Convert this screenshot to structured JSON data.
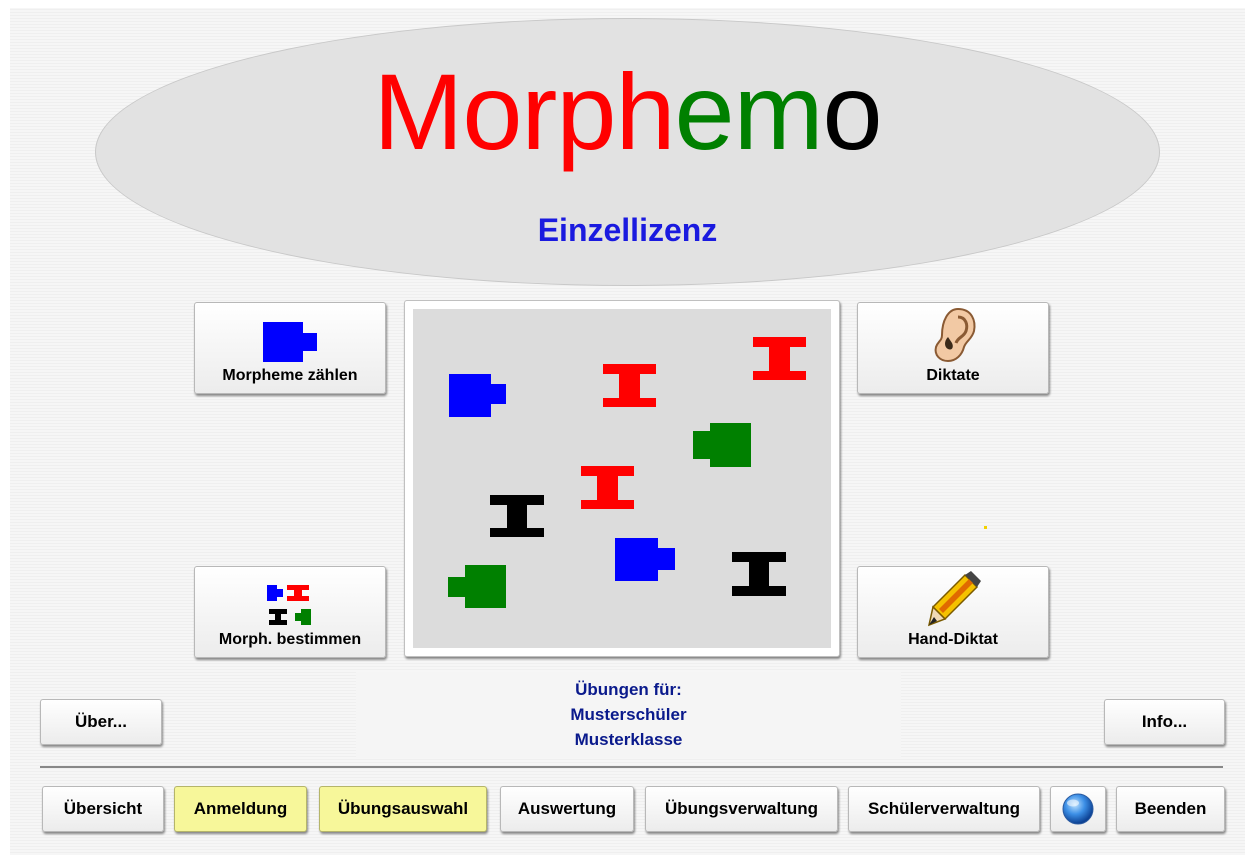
{
  "header": {
    "title_parts": [
      {
        "text": "Morp",
        "color": "#ff0000"
      },
      {
        "text": "h",
        "color": "#ff0000"
      },
      {
        "text": "em",
        "color": "#008000"
      },
      {
        "text": "o",
        "color": "#000000"
      }
    ],
    "license": "Einzellizenz"
  },
  "tiles": {
    "count_label": "Morpheme zählen",
    "determine_label": "Morph. bestimmen",
    "dictation_label": "Diktate",
    "hand_dictation_label": "Hand-Diktat"
  },
  "center_pieces": [
    {
      "type": "block",
      "color": "blue"
    },
    {
      "type": "ibeam",
      "color": "red"
    },
    {
      "type": "ibeam",
      "color": "red"
    },
    {
      "type": "block",
      "color": "green"
    },
    {
      "type": "ibeam",
      "color": "red"
    },
    {
      "type": "ibeam",
      "color": "black"
    },
    {
      "type": "block",
      "color": "blue"
    },
    {
      "type": "ibeam",
      "color": "black"
    },
    {
      "type": "block",
      "color": "green"
    }
  ],
  "users": {
    "heading": "Übungen für:",
    "student": "Musterschüler",
    "class": "Musterklasse"
  },
  "side_buttons": {
    "about": "Über...",
    "info": "Info..."
  },
  "toolbar": {
    "overview": "Übersicht",
    "login": "Anmeldung",
    "exercise_selection": "Übungsauswahl",
    "evaluation": "Auswertung",
    "exercise_management": "Übungsverwaltung",
    "student_management": "Schülerverwaltung",
    "globe_icon": "globe-icon",
    "quit": "Beenden"
  },
  "colors": {
    "active_button": "#f7f79a",
    "user_text": "#0a1a8c",
    "license_text": "#1a1adf",
    "piece_blue": "#0000ff",
    "piece_red": "#ff0000",
    "piece_green": "#008000",
    "piece_black": "#000000"
  }
}
